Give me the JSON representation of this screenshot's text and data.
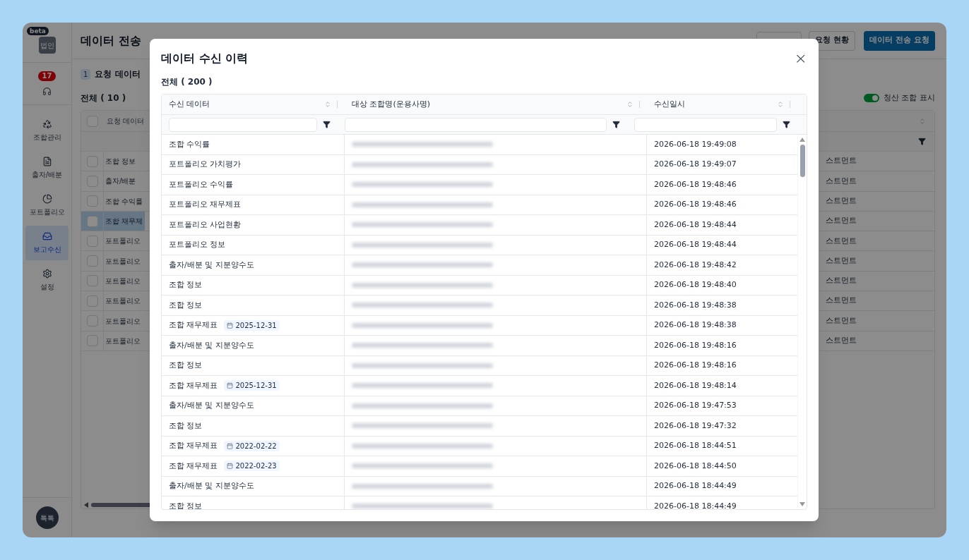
{
  "sidebar": {
    "logo": "법인",
    "badge": "beta",
    "notification_count": "17",
    "items": [
      {
        "label": "조합관리",
        "kind": "recycle",
        "selected": false
      },
      {
        "label": "출자/배분",
        "kind": "file",
        "selected": false
      },
      {
        "label": "포트폴리오",
        "kind": "pie",
        "selected": false
      },
      {
        "label": "보고수신",
        "kind": "inbox",
        "selected": true
      },
      {
        "label": "설정",
        "kind": "settings",
        "selected": false
      }
    ],
    "avatar": "톡톡"
  },
  "page": {
    "title": "데이터 전송",
    "buttons": [
      {
        "label": "요청 현황",
        "kind": "outline"
      },
      {
        "label": "데이터 전송 요청",
        "kind": "primary"
      }
    ],
    "step": {
      "number": "1",
      "label": "요청 데이터"
    },
    "total": "전체 ( 10 )",
    "toggle": {
      "label": "청산 조합 표시",
      "on": true
    },
    "table": {
      "header_checked": false,
      "column_1": "요청 데이터",
      "rows": [
        {
          "checked": false,
          "selected": false,
          "column_1": "조합 정보",
          "column_3": "스트먼트"
        },
        {
          "checked": false,
          "selected": false,
          "column_1": "출자/배분",
          "column_3": "스트먼트"
        },
        {
          "checked": false,
          "selected": false,
          "column_1": "조합 수익률",
          "column_3": "스트먼트"
        },
        {
          "checked": false,
          "selected": true,
          "column_1": "조합 재무제",
          "column_3": "스트먼트"
        },
        {
          "checked": false,
          "selected": false,
          "column_1": "포트폴리오",
          "column_3": "스트먼트"
        },
        {
          "checked": false,
          "selected": false,
          "column_1": "포트폴리오",
          "column_3": "스트먼트"
        },
        {
          "checked": false,
          "selected": false,
          "column_1": "포트폴리오",
          "column_3": "스트먼트"
        },
        {
          "checked": false,
          "selected": false,
          "column_1": "포트폴리오",
          "column_3": "스트먼트"
        },
        {
          "checked": false,
          "selected": false,
          "column_1": "포트폴리오",
          "column_3": "스트먼트"
        },
        {
          "checked": false,
          "selected": false,
          "column_1": "포트폴리오",
          "column_3": "스트먼트"
        }
      ]
    }
  },
  "modal": {
    "title": "데이터 수신 이력",
    "close": "×",
    "total": "전체 ( 200 )",
    "columns": [
      "수신 데이터",
      "대상 조합명(운용사명)",
      "수신일시"
    ],
    "rows": [
      {
        "data": "조합 수익률",
        "received_at": "2026-06-18 19:49:08"
      },
      {
        "data": "포트폴리오 가치평가",
        "received_at": "2026-06-18 19:49:07"
      },
      {
        "data": "포트폴리오 수익률",
        "received_at": "2026-06-18 19:48:46"
      },
      {
        "data": "포트폴리오 재무제표",
        "received_at": "2026-06-18 19:48:46"
      },
      {
        "data": "포트폴리오 사업현황",
        "received_at": "2026-06-18 19:48:44"
      },
      {
        "data": "포트폴리오 정보",
        "received_at": "2026-06-18 19:48:44"
      },
      {
        "data": "출자/배분 및 지분양수도",
        "received_at": "2026-06-18 19:48:42"
      },
      {
        "data": "조합 정보",
        "received_at": "2026-06-18 19:48:40"
      },
      {
        "data": "조합 정보",
        "received_at": "2026-06-18 19:48:38"
      },
      {
        "data": "조합 재무제표",
        "date_tag": "2025-12-31",
        "received_at": "2026-06-18 19:48:38"
      },
      {
        "data": "출자/배분 및 지분양수도",
        "received_at": "2026-06-18 19:48:16"
      },
      {
        "data": "조합 정보",
        "received_at": "2026-06-18 19:48:16"
      },
      {
        "data": "조합 재무제표",
        "date_tag": "2025-12-31",
        "received_at": "2026-06-18 19:48:14"
      },
      {
        "data": "출자/배분 및 지분양수도",
        "received_at": "2026-06-18 19:47:53"
      },
      {
        "data": "조합 정보",
        "received_at": "2026-06-18 19:47:32"
      },
      {
        "data": "조합 재무제표",
        "date_tag": "2022-02-22",
        "received_at": "2026-06-18 18:44:51"
      },
      {
        "data": "조합 재무제표",
        "date_tag": "2022-02-23",
        "received_at": "2026-06-18 18:44:50"
      },
      {
        "data": "출자/배분 및 지분양수도",
        "received_at": "2026-06-18 18:44:49"
      },
      {
        "data": "조합 정보",
        "received_at": "2026-06-18 18:44:49"
      }
    ]
  }
}
